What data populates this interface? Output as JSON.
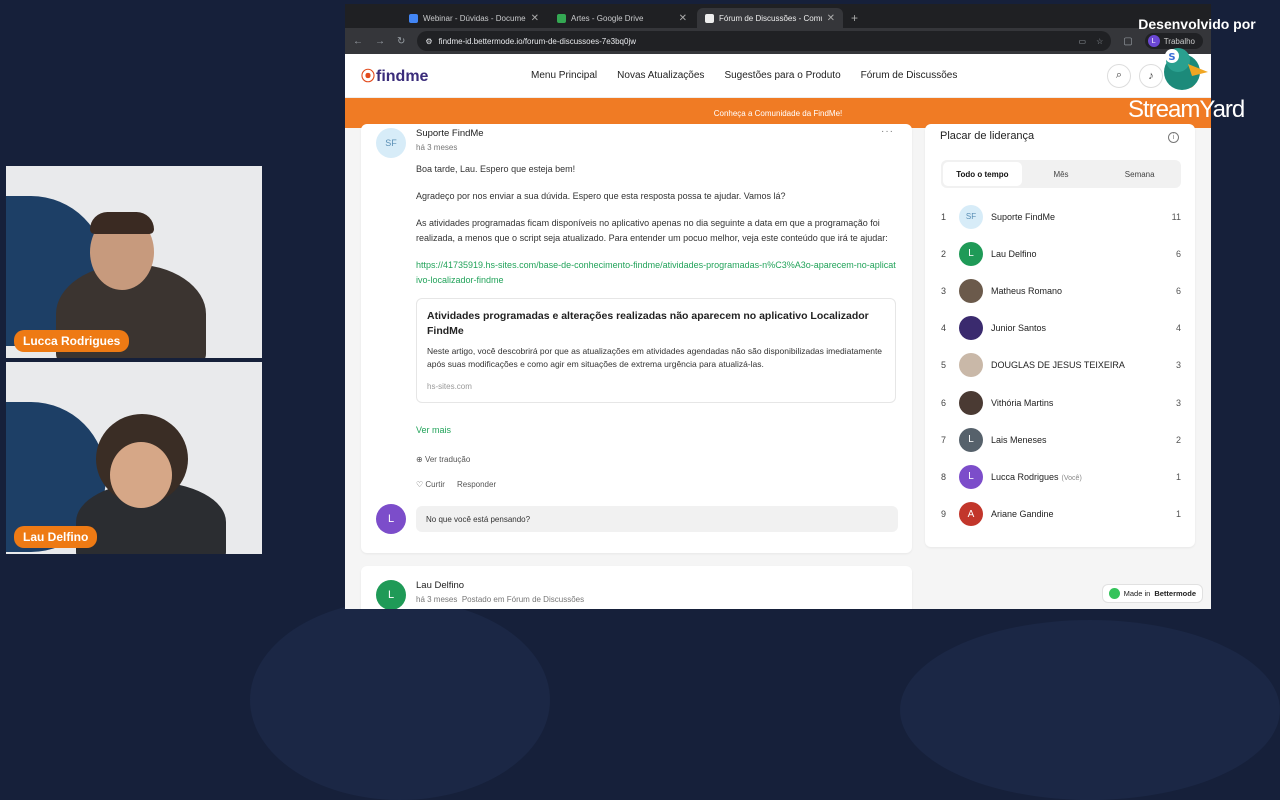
{
  "browser": {
    "tabs": [
      {
        "title": "Webinar - Dúvidas - Documen...",
        "icon_color": "#4285f4",
        "active": false
      },
      {
        "title": "Artes - Google Drive",
        "icon_color": "#34a853",
        "active": false
      },
      {
        "title": "Fórum de Discussões - Comu...",
        "icon_color": "#eeeeee",
        "active": true
      }
    ],
    "url": "findme-id.bettermode.io/forum-de-discussoes-7e3bq0jw",
    "profile_label": "Trabalho",
    "profile_initial": "L"
  },
  "site": {
    "logo_text": "findme",
    "nav": [
      "Menu Principal",
      "Novas Atualizações",
      "Sugestões para o Produto",
      "Fórum de Discussões"
    ],
    "banner": "Conheça a Comunidade da FindMe!"
  },
  "post": {
    "author": "Suporte FindMe",
    "author_initials": "SF",
    "time": "há 3 meses",
    "paragraphs": [
      "Boa tarde, Lau. Espero que esteja bem!",
      "Agradeço por nos enviar a sua dúvida. Espero que esta resposta possa te ajudar. Vamos lá?",
      "As atividades programadas ficam disponíveis no aplicativo apenas no dia seguinte a data em que a programação foi realizada, a menos que o script seja atualizado. Para entender um pocuo melhor, veja este conteúdo que irá te ajudar:"
    ],
    "link": "https://41735919.hs-sites.com/base-de-conhecimento-findme/atividades-programadas-n%C3%A3o-aparecem-no-aplicativo-localizador-findme",
    "preview": {
      "title": "Atividades programadas e alterações realizadas não aparecem no aplicativo Localizador FindMe",
      "description": "Neste artigo, você descobrirá por que as atualizações em atividades agendadas não são disponibilizadas imediatamente após suas modificações e como agir em situações de extrema urgência para atualizá-las.",
      "host": "hs-sites.com"
    },
    "see_more": "Ver mais",
    "translate": "Ver tradução",
    "like": "Curtir",
    "reply": "Responder",
    "comment_placeholder": "No que você está pensando?",
    "commenter_initial": "L"
  },
  "post2": {
    "author": "Lau Delfino",
    "initial": "L",
    "time": "há 3 meses",
    "posted_in": "Postado em Fórum de Discussões"
  },
  "leaderboard": {
    "title": "Placar de liderança",
    "tabs": [
      "Todo o tempo",
      "Mês",
      "Semana"
    ],
    "entries": [
      {
        "rank": "1",
        "name": "Suporte FindMe",
        "score": "11",
        "avatar": "SF",
        "color": "#d7ecf8",
        "text_color": "#5a8fb5",
        "you": ""
      },
      {
        "rank": "2",
        "name": "Lau Delfino",
        "score": "6",
        "avatar": "L",
        "color": "#1f9a57",
        "text_color": "#ffffff",
        "you": ""
      },
      {
        "rank": "3",
        "name": "Matheus Romano",
        "score": "6",
        "avatar": "",
        "color": "#6b5a4b",
        "text_color": "#ffffff",
        "you": ""
      },
      {
        "rank": "4",
        "name": "Junior Santos",
        "score": "4",
        "avatar": "",
        "color": "#3a2a6e",
        "text_color": "#ffffff",
        "you": ""
      },
      {
        "rank": "5",
        "name": "DOUGLAS DE JESUS TEIXEIRA",
        "score": "3",
        "avatar": "",
        "color": "#c9b8a8",
        "text_color": "#ffffff",
        "you": ""
      },
      {
        "rank": "6",
        "name": "Vithória Martins",
        "score": "3",
        "avatar": "",
        "color": "#4a3a33",
        "text_color": "#ffffff",
        "you": ""
      },
      {
        "rank": "7",
        "name": "Lais Meneses",
        "score": "2",
        "avatar": "L",
        "color": "#56616b",
        "text_color": "#ffffff",
        "you": ""
      },
      {
        "rank": "8",
        "name": "Lucca Rodrigues",
        "score": "1",
        "avatar": "L",
        "color": "#7c4dca",
        "text_color": "#ffffff",
        "you": "(Você)"
      },
      {
        "rank": "9",
        "name": "Ariane Gandine",
        "score": "1",
        "avatar": "A",
        "color": "#c2362b",
        "text_color": "#ffffff",
        "you": ""
      }
    ]
  },
  "made_in": {
    "prefix": "Made in",
    "brand": "Bettermode"
  },
  "participants": [
    "Lucca Rodrigues",
    "Lau Delfino"
  ],
  "watermark": {
    "by": "Desenvolvido por",
    "brand": "StreamYard"
  }
}
